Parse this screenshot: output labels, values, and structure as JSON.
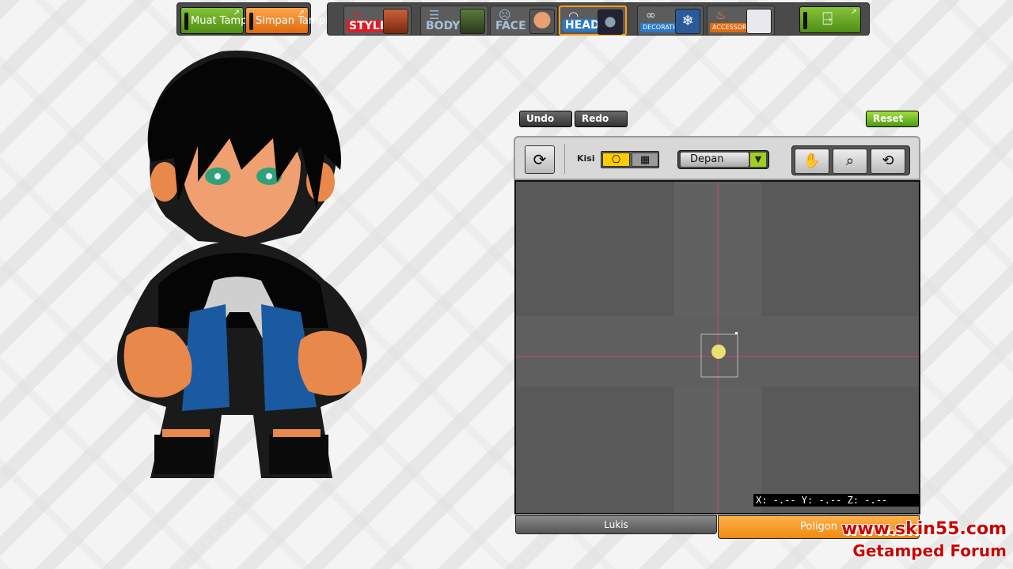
{
  "top_left": {
    "load_label": "Muat Tampilan",
    "save_label": "Simpan Tampilan"
  },
  "categories": [
    {
      "label": "STYLE",
      "label_color": "#d8202a",
      "icon": "style-icon"
    },
    {
      "label": "BODY",
      "label_color": "#6a8aa8",
      "icon": "body-icon"
    },
    {
      "label": "FACE",
      "label_color": "#6a8aa8",
      "icon": "face-icon"
    },
    {
      "label": "HEAD",
      "label_color": "#2a7ac8",
      "icon": "head-icon"
    },
    {
      "label": "DECORATION",
      "label_color": "#2a7ac8",
      "icon": "glasses-icon"
    },
    {
      "label": "ACCESSORY",
      "label_color": "#e06a10",
      "icon": "flame-icon"
    }
  ],
  "editor": {
    "undo_label": "Undo",
    "redo_label": "Redo",
    "reset_label": "Reset",
    "grid_label": "Kisi",
    "view_select_value": "Depan",
    "coords_text": "X: -.-- Y: -.-- Z: -.--",
    "tab_left_label": "Lukis",
    "tab_right_label": "Poligon"
  },
  "watermark": {
    "site": "www.skin55.com",
    "forum": "Getamped Forum"
  },
  "colors": {
    "accent_orange": "#f08a12",
    "accent_green": "#5aa814",
    "viewport_bg": "#595959"
  }
}
